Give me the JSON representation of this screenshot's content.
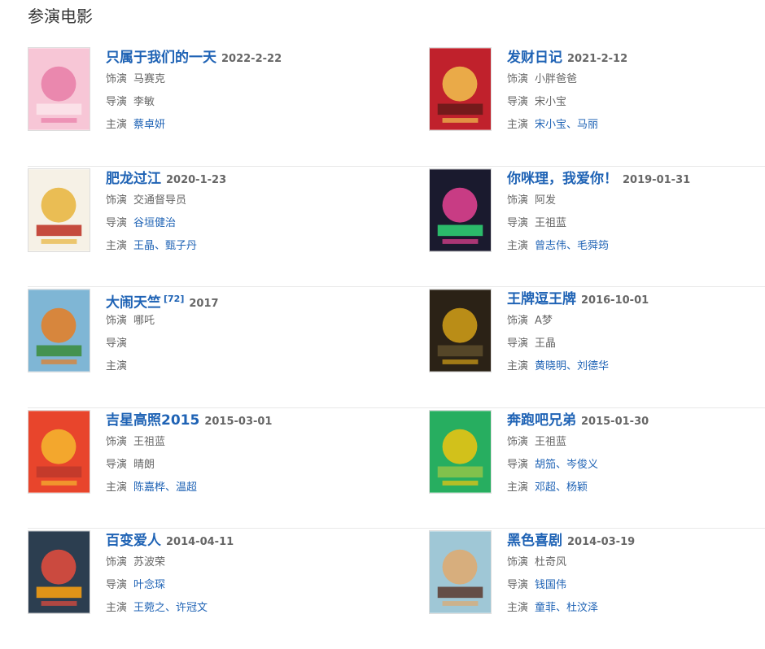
{
  "section_title": "参演电影",
  "labels": {
    "role": "饰演",
    "director": "导演",
    "cast": "主演"
  },
  "movies": [
    {
      "title": "只属于我们的一天",
      "ref": "",
      "date": "2022-2-22",
      "role": "马赛克",
      "director": "李敏",
      "director_link": false,
      "cast": [
        "蔡卓妍"
      ],
      "poster_colors": [
        "#f7c6d6",
        "#e87ca7",
        "#fbe3ea"
      ]
    },
    {
      "title": "发财日记",
      "ref": "",
      "date": "2021-2-12",
      "role": "小胖爸爸",
      "director": "宋小宝",
      "director_link": false,
      "cast": [
        "宋小宝",
        "马丽"
      ],
      "poster_colors": [
        "#c0212c",
        "#f1c24d",
        "#6b1a1a"
      ]
    },
    {
      "title": "肥龙过江",
      "ref": "",
      "date": "2020-1-23",
      "role": "交通督导员",
      "director": "谷垣健治",
      "director_link": true,
      "cast": [
        "王晶",
        "甄子丹"
      ],
      "poster_colors": [
        "#f6f1e6",
        "#e8b43a",
        "#c0392b"
      ]
    },
    {
      "title": "你咪理，我爱你！",
      "ref": "",
      "date": "2019-01-31",
      "role": "阿发",
      "director": "王祖蓝",
      "director_link": false,
      "cast": [
        "曾志伟",
        "毛舜筠"
      ],
      "poster_colors": [
        "#1a1a2e",
        "#e84393",
        "#2ecc71"
      ]
    },
    {
      "title": "大闹天竺",
      "ref": "[72]",
      "date": "2017",
      "role": "哪吒",
      "director": "",
      "director_link": false,
      "cast": [],
      "poster_colors": [
        "#7fb6d5",
        "#e67e22",
        "#3e8e41"
      ]
    },
    {
      "title": "王牌逗王牌",
      "ref": "",
      "date": "2016-10-01",
      "role": "A梦",
      "director": "王晶",
      "director_link": false,
      "cast": [
        "黄晓明",
        "刘德华"
      ],
      "poster_colors": [
        "#2b2216",
        "#d4a017",
        "#5a4a2a"
      ]
    },
    {
      "title": "吉星高照2015",
      "ref": "",
      "date": "2015-03-01",
      "role": "王祖蓝",
      "director": "晴朗",
      "director_link": false,
      "cast": [
        "陈嘉桦",
        "温超"
      ],
      "poster_colors": [
        "#e8452c",
        "#f5b82e",
        "#c0392b"
      ]
    },
    {
      "title": "奔跑吧兄弟",
      "ref": "",
      "date": "2015-01-30",
      "role": "王祖蓝",
      "director": "胡笳、岑俊义",
      "director_link": true,
      "cast": [
        "邓超",
        "杨颖"
      ],
      "poster_colors": [
        "#27ae60",
        "#f1c40f",
        "#8bc34a"
      ]
    },
    {
      "title": "百变爱人",
      "ref": "",
      "date": "2014-04-11",
      "role": "苏波荣",
      "director": "叶念琛",
      "director_link": true,
      "cast": [
        "王菀之",
        "许冠文"
      ],
      "poster_colors": [
        "#2c3e50",
        "#e74c3c",
        "#f39c12"
      ]
    },
    {
      "title": "黑色喜剧",
      "ref": "",
      "date": "2014-03-19",
      "role": "杜奇风",
      "director": "钱国伟",
      "director_link": true,
      "cast": [
        "童菲",
        "杜汶泽"
      ],
      "poster_colors": [
        "#9fc7d6",
        "#e0a96d",
        "#5d4037"
      ]
    }
  ]
}
